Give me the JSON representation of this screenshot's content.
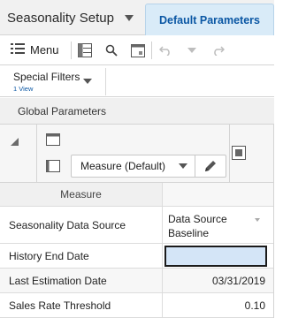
{
  "tabs": [
    {
      "label": "Seasonality Setup",
      "active": false
    },
    {
      "label": "Default Parameters",
      "active": true
    }
  ],
  "toolbar": {
    "menu_label": "Menu",
    "icons": [
      "menu-icon",
      "pivot-icon",
      "search-icon",
      "calendar-icon",
      "undo-icon",
      "dropdown-icon",
      "redo-icon"
    ]
  },
  "filters": {
    "title": "Special Filters",
    "subtitle": "1 View"
  },
  "section": {
    "title": "Global Parameters"
  },
  "pivot": {
    "measure_dropdown": "Measure (Default)"
  },
  "grid": {
    "header": "Measure",
    "rows": [
      {
        "label": "Seasonality Data Source",
        "value_line1": "Data Source",
        "value_line2": "Baseline"
      },
      {
        "label": "History End Date",
        "value": ""
      },
      {
        "label": "Last Estimation Date",
        "value": "03/31/2019"
      },
      {
        "label": "Sales Rate Threshold",
        "value": "0.10"
      }
    ]
  },
  "colors": {
    "active_tab_bg": "#d9ebf8",
    "active_tab_text": "#0b57a4",
    "edit_cell_bg": "#d4e5f7"
  }
}
